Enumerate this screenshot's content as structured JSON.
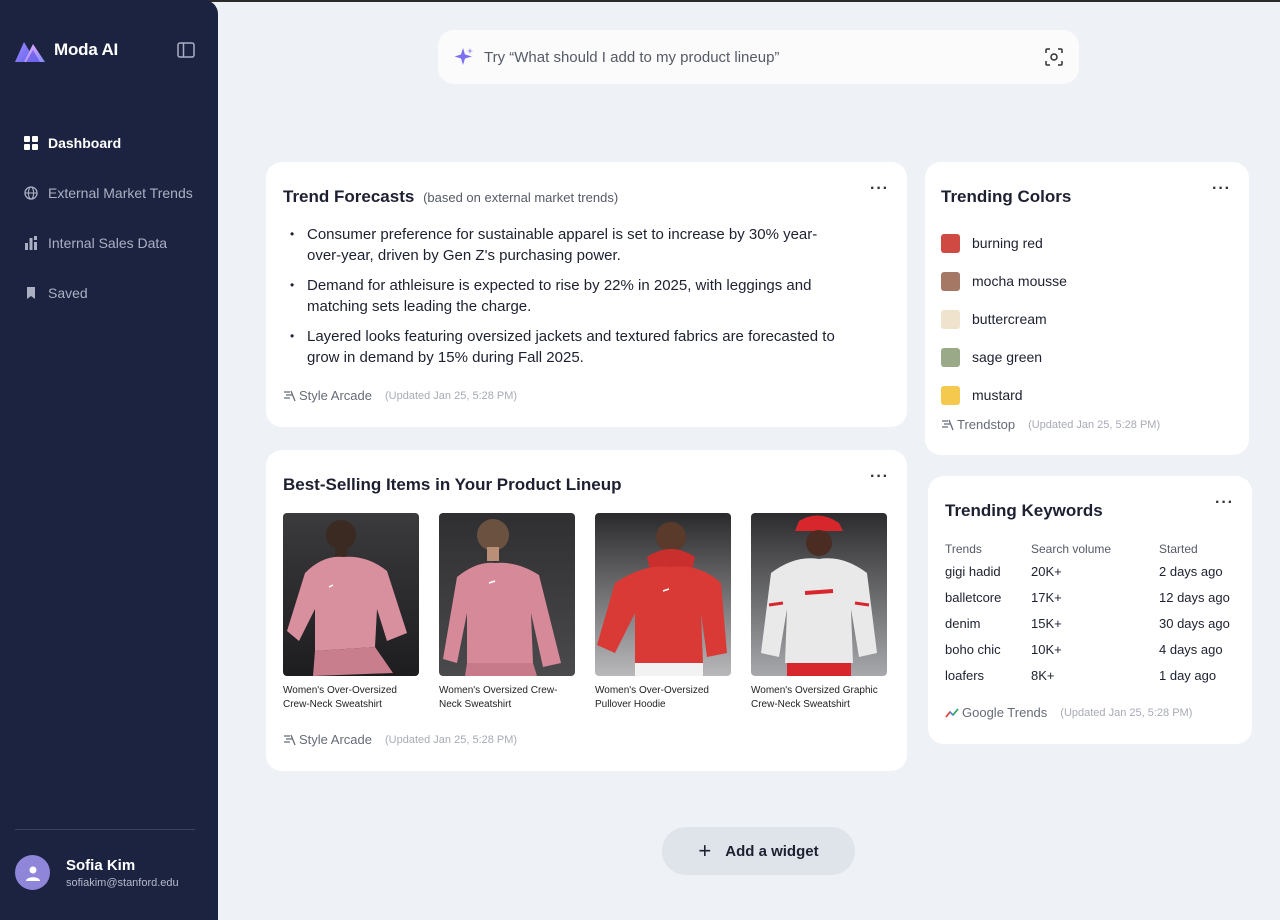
{
  "app": {
    "name": "Moda AI"
  },
  "sidebar": {
    "items": [
      {
        "label": "Dashboard",
        "icon": "grid-icon",
        "active": true
      },
      {
        "label": "External Market Trends",
        "icon": "globe-icon",
        "active": false
      },
      {
        "label": "Internal Sales Data",
        "icon": "bar-chart-icon",
        "active": false
      },
      {
        "label": "Saved",
        "icon": "bookmark-icon",
        "active": false
      }
    ],
    "user": {
      "name": "Sofia Kim",
      "email": "sofiakim@stanford.edu"
    }
  },
  "search": {
    "placeholder": "Try “What should I add to my product lineup”"
  },
  "trend_forecasts": {
    "title": "Trend Forecasts",
    "subtitle": "(based on external market trends)",
    "bullets": [
      "Consumer preference for sustainable apparel is set to increase by 30% year-over-year, driven by Gen Z's purchasing power.",
      "Demand for athleisure is expected to rise by 22% in 2025, with leggings and matching sets leading the charge.",
      "Layered looks featuring oversized jackets and textured fabrics are forecasted to grow in demand by 15% during Fall 2025."
    ],
    "source": "Style Arcade",
    "updated": "(Updated  Jan 25, 5:28 PM)"
  },
  "best_selling": {
    "title": "Best-Selling Items in Your Product Lineup",
    "products": [
      {
        "name": "Women's Over-Oversized Crew-Neck Sweatshirt",
        "color": "#d9909e"
      },
      {
        "name": "Women's Oversized Crew-Neck Sweatshirt",
        "color": "#d68a99"
      },
      {
        "name": "Women's Over-Oversized Pullover Hoodie",
        "color": "#d93a36"
      },
      {
        "name": "Women's Oversized Graphic Crew-Neck Sweatshirt",
        "color": "#e9e9ea"
      }
    ],
    "source": "Style Arcade",
    "updated": "(Updated  Jan 25, 5:28 PM)"
  },
  "trending_colors": {
    "title": "Trending Colors",
    "colors": [
      {
        "name": "burning red",
        "hex": "#cf4a43"
      },
      {
        "name": "mocha mousse",
        "hex": "#a47864"
      },
      {
        "name": "buttercream",
        "hex": "#efe3cd"
      },
      {
        "name": "sage green",
        "hex": "#9aaa88"
      },
      {
        "name": "mustard",
        "hex": "#f4c94d"
      }
    ],
    "source": "Trendstop",
    "updated": "(Updated  Jan 25, 5:28 PM)"
  },
  "trending_keywords": {
    "title": "Trending Keywords",
    "headers": [
      "Trends",
      "Search volume",
      "Started"
    ],
    "rows": [
      [
        "gigi hadid",
        "20K+",
        "2 days ago"
      ],
      [
        "balletcore",
        "17K+",
        "12 days ago"
      ],
      [
        "denim",
        "15K+",
        "30 days ago"
      ],
      [
        "boho chic",
        "10K+",
        "4 days ago"
      ],
      [
        "loafers",
        "8K+",
        "1 day ago"
      ]
    ],
    "source": "Google Trends",
    "updated": "(Updated  Jan 25, 5:28 PM)"
  },
  "add_widget": {
    "label": "Add a widget"
  },
  "colors": {
    "sidebar_bg": "#1c2340",
    "page_bg": "#eef1f6",
    "accent": "#7b6ff2"
  }
}
